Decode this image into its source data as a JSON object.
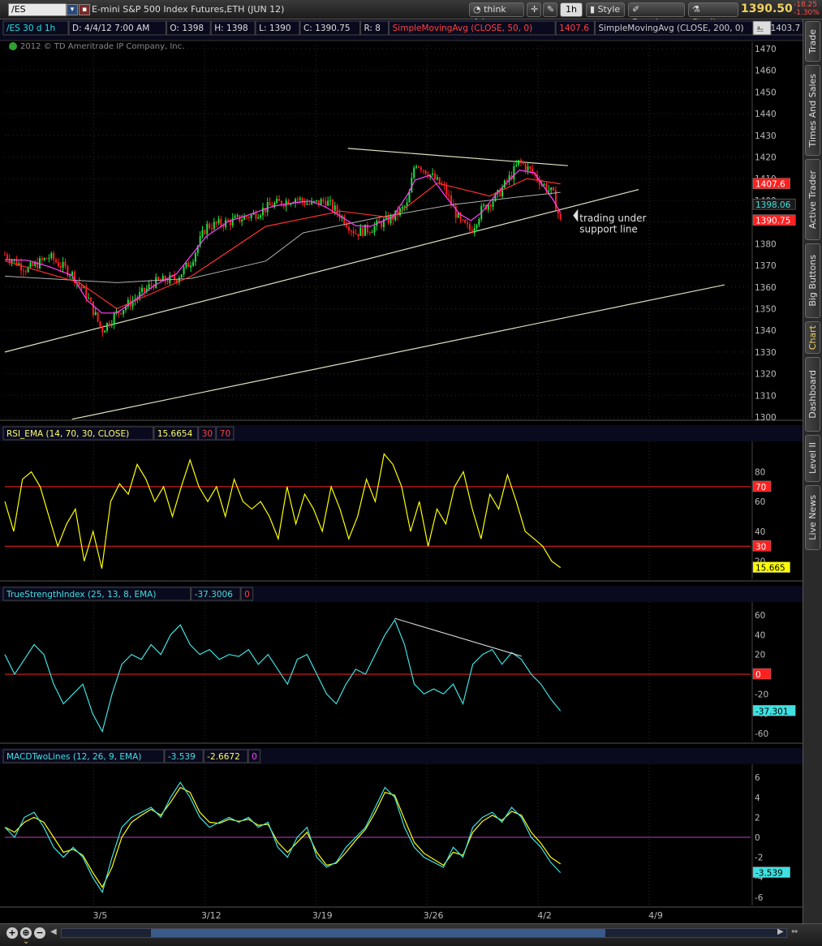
{
  "toolbar": {
    "symbol": "/ES",
    "description": "E-mini S&P 500 Index Futures,ETH (JUN 12)",
    "think_label": "think A.I.",
    "interval": "1h",
    "style_label": "Style",
    "drawings_label": "Drawings",
    "studies_label": "Studies",
    "last_price": "1390.50",
    "change": "-18.25",
    "change_pct": "-1.30%"
  },
  "side_tabs": [
    "Trade",
    "Times And Sales",
    "Active Trader",
    "Big Buttons",
    "Chart",
    "Dashboard",
    "Level II",
    "Live News"
  ],
  "price_panel": {
    "header": {
      "symbol_period": "/ES 30 d 1h",
      "date": "D: 4/4/12 7:00 AM",
      "open": "O: 1398",
      "high": "H: 1398",
      "low": "L: 1390",
      "close": "C: 1390.75",
      "r": "R: 8",
      "sma50_label": "SimpleMovingAvg (CLOSE, 50, 0)",
      "sma50_value": "1407.6",
      "sma200_label": "SimpleMovingAvg (CLOSE, 200, 0)",
      "sma200_value": "1403.7",
      "sim": "Sim"
    },
    "copyright": "2012 © TD Ameritrade IP Company, Inc.",
    "y_ticks": [
      "1470",
      "1460",
      "1450",
      "1440",
      "1430",
      "1420",
      "1410",
      "1400",
      "1390",
      "1380",
      "1370",
      "1360",
      "1350",
      "1340",
      "1330",
      "1320",
      "1310",
      "1300"
    ],
    "ylim": [
      1300,
      1470
    ],
    "badges": [
      {
        "text": "1407.6",
        "value": 1407.6,
        "bg": "#ff2020",
        "fg": "#ffffff"
      },
      {
        "text": "1398.06",
        "value": 1398.06,
        "bg": "#1a1a1a",
        "fg": "#40e0e0"
      },
      {
        "text": "1390.75",
        "value": 1390.75,
        "bg": "#ff2020",
        "fg": "#ffffff"
      }
    ],
    "annotation_line1": "trading under",
    "annotation_line2": "support line"
  },
  "rsi_panel": {
    "header": {
      "label": "RSI_EMA (14, 70, 30, CLOSE)",
      "value": "15.6654",
      "low": "30",
      "high": "70"
    },
    "y_ticks": [
      "80",
      "60",
      "40",
      "20"
    ],
    "ylim": [
      10,
      95
    ],
    "badges": [
      {
        "text": "70",
        "value": 70,
        "bg": "#ff2020",
        "fg": "#ffffff"
      },
      {
        "text": "30",
        "value": 30,
        "bg": "#ff2020",
        "fg": "#ffffff"
      },
      {
        "text": "15.665",
        "value": 15.665,
        "bg": "#ffff00",
        "fg": "#000000"
      }
    ]
  },
  "tsi_panel": {
    "header": {
      "label": "TrueStrengthIndex (25, 13, 8, EMA)",
      "value": "-37.3006",
      "zero": "0"
    },
    "y_ticks": [
      "60",
      "40",
      "20",
      "-20",
      "-40",
      "-60"
    ],
    "ylim": [
      -65,
      65
    ],
    "badges": [
      {
        "text": "0",
        "value": 0,
        "bg": "#ff2020",
        "fg": "#ffffff"
      },
      {
        "text": "-37.301",
        "value": -37.301,
        "bg": "#40e0e0",
        "fg": "#000000"
      }
    ]
  },
  "macd_panel": {
    "header": {
      "label": "MACDTwoLines (12, 26, 9, EMA)",
      "value": "-3.539",
      "avg": "-2.6672",
      "zero": "0"
    },
    "y_ticks": [
      "6",
      "4",
      "2",
      "0",
      "-2",
      "-4",
      "-6"
    ],
    "ylim": [
      -6.5,
      6.5
    ],
    "badges": [
      {
        "text": "-3.539",
        "value": -3.539,
        "bg": "#40e0e0",
        "fg": "#000000"
      }
    ]
  },
  "x_axis": {
    "labels": [
      "3/5",
      "3/12",
      "3/19",
      "3/26",
      "4/2",
      "4/9"
    ]
  },
  "colors": {
    "price_up": "#20e040",
    "price_down": "#ff2020",
    "sma_fast": "#ff3030",
    "sma_mid": "#ff40ff",
    "sma_200": "#b0b0b0",
    "trendline": "#e0e0c0",
    "rsi": "#ffff00",
    "tsi": "#40e0e0",
    "macd": "#40e0e0",
    "macd_avg": "#ffff00",
    "grid": "#2a2a2a",
    "level_line": "#ff2020",
    "zero_line": "#c040c0"
  },
  "chart_data": [
    {
      "type": "candlestick",
      "title": "E-mini S&P 500 Index Futures,ETH (JUN 12)",
      "ylim": [
        1300,
        1470
      ],
      "x_labels": [
        "3/5",
        "3/12",
        "3/19",
        "3/26",
        "4/2",
        "4/9"
      ],
      "close_path": [
        [
          0,
          1375
        ],
        [
          0.03,
          1368
        ],
        [
          0.06,
          1374
        ],
        [
          0.09,
          1366
        ],
        [
          0.11,
          1356
        ],
        [
          0.13,
          1340
        ],
        [
          0.15,
          1348
        ],
        [
          0.18,
          1356
        ],
        [
          0.2,
          1362
        ],
        [
          0.23,
          1364
        ],
        [
          0.25,
          1372
        ],
        [
          0.27,
          1388
        ],
        [
          0.3,
          1390
        ],
        [
          0.33,
          1393
        ],
        [
          0.36,
          1398
        ],
        [
          0.39,
          1401
        ],
        [
          0.41,
          1398
        ],
        [
          0.43,
          1400
        ],
        [
          0.45,
          1393
        ],
        [
          0.47,
          1385
        ],
        [
          0.49,
          1387
        ],
        [
          0.52,
          1392
        ],
        [
          0.54,
          1398
        ],
        [
          0.55,
          1418
        ],
        [
          0.57,
          1412
        ],
        [
          0.59,
          1405
        ],
        [
          0.61,
          1390
        ],
        [
          0.625,
          1386
        ],
        [
          0.64,
          1396
        ],
        [
          0.66,
          1402
        ],
        [
          0.68,
          1412
        ],
        [
          0.69,
          1418
        ],
        [
          0.71,
          1412
        ],
        [
          0.72,
          1408
        ],
        [
          0.735,
          1403
        ],
        [
          0.745,
          1390
        ]
      ],
      "sma50_path": [
        [
          0,
          1372
        ],
        [
          0.1,
          1362
        ],
        [
          0.15,
          1350
        ],
        [
          0.25,
          1365
        ],
        [
          0.35,
          1388
        ],
        [
          0.45,
          1395
        ],
        [
          0.52,
          1392
        ],
        [
          0.58,
          1408
        ],
        [
          0.65,
          1402
        ],
        [
          0.7,
          1410
        ],
        [
          0.745,
          1407.6
        ]
      ],
      "sma200_path": [
        [
          0,
          1365
        ],
        [
          0.15,
          1362
        ],
        [
          0.25,
          1364
        ],
        [
          0.35,
          1372
        ],
        [
          0.4,
          1385
        ],
        [
          0.5,
          1392
        ],
        [
          0.6,
          1398
        ],
        [
          0.7,
          1402
        ],
        [
          0.745,
          1403.7
        ]
      ],
      "trendlines": [
        {
          "from": [
            0,
            1330
          ],
          "to": [
            0.85,
            1405
          ]
        },
        {
          "from": [
            0.09,
            1299
          ],
          "to": [
            0.965,
            1361
          ]
        },
        {
          "from": [
            0.46,
            1424
          ],
          "to": [
            0.755,
            1416
          ]
        }
      ]
    },
    {
      "type": "line",
      "title": "RSI_EMA (14, 70, 30, CLOSE)",
      "ylim": [
        10,
        95
      ],
      "levels": [
        70,
        30
      ],
      "values": [
        60,
        40,
        75,
        80,
        70,
        50,
        30,
        45,
        55,
        20,
        40,
        15,
        60,
        72,
        65,
        85,
        75,
        60,
        70,
        50,
        70,
        88,
        70,
        60,
        70,
        50,
        75,
        60,
        55,
        60,
        50,
        35,
        70,
        45,
        65,
        55,
        40,
        70,
        55,
        35,
        50,
        75,
        60,
        92,
        85,
        70,
        40,
        60,
        30,
        55,
        45,
        70,
        80,
        55,
        35,
        65,
        55,
        78,
        60,
        40,
        35,
        30,
        20,
        15.6654
      ]
    },
    {
      "type": "line",
      "title": "TrueStrengthIndex (25, 13, 8, EMA)",
      "ylim": [
        -65,
        65
      ],
      "values": [
        20,
        0,
        15,
        30,
        20,
        -10,
        -30,
        -20,
        -10,
        -40,
        -58,
        -20,
        10,
        20,
        15,
        30,
        20,
        40,
        50,
        30,
        20,
        25,
        15,
        20,
        18,
        25,
        10,
        20,
        5,
        -10,
        15,
        20,
        0,
        -20,
        -30,
        -10,
        5,
        0,
        20,
        40,
        55,
        30,
        -10,
        -20,
        -15,
        -20,
        -10,
        -30,
        10,
        20,
        25,
        10,
        22,
        15,
        0,
        -10,
        -25,
        -37.3006
      ],
      "annotation_line": {
        "from_index": 40,
        "to_index": 53
      }
    },
    {
      "type": "line",
      "title": "MACDTwoLines (12, 26, 9, EMA)",
      "ylim": [
        -6.5,
        6.5
      ],
      "series": [
        {
          "name": "Value",
          "values": [
            1,
            0,
            2,
            2.5,
            1,
            -1,
            -2,
            -1,
            -2,
            -4,
            -5.5,
            -2,
            1,
            2,
            2.5,
            3,
            2,
            4,
            5.5,
            4,
            2,
            1,
            1.5,
            2,
            1.5,
            2,
            1,
            1.5,
            -1,
            -2,
            0,
            1,
            -2,
            -3,
            -2.5,
            -1,
            0,
            1,
            3,
            5,
            4,
            1,
            -1,
            -2,
            -2.5,
            -3,
            -1,
            -2,
            1,
            2,
            2.5,
            1.5,
            3,
            2,
            0,
            -1,
            -2.5,
            -3.539
          ]
        },
        {
          "name": "Avg",
          "values": [
            1,
            0.5,
            1.5,
            2,
            1.5,
            0,
            -1.5,
            -1.2,
            -1.8,
            -3.5,
            -5,
            -3,
            0,
            1.5,
            2.2,
            2.8,
            2.2,
            3.5,
            5,
            4.5,
            2.5,
            1.5,
            1.4,
            1.8,
            1.6,
            1.8,
            1.2,
            1.3,
            -0.5,
            -1.5,
            -0.5,
            0.5,
            -1.5,
            -2.8,
            -2.6,
            -1.5,
            -0.3,
            0.8,
            2.5,
            4.5,
            4.2,
            1.8,
            -0.5,
            -1.6,
            -2.2,
            -2.8,
            -1.5,
            -1.8,
            0.5,
            1.6,
            2.2,
            1.7,
            2.6,
            2.2,
            0.5,
            -0.6,
            -2,
            -2.6672
          ]
        }
      ]
    }
  ]
}
